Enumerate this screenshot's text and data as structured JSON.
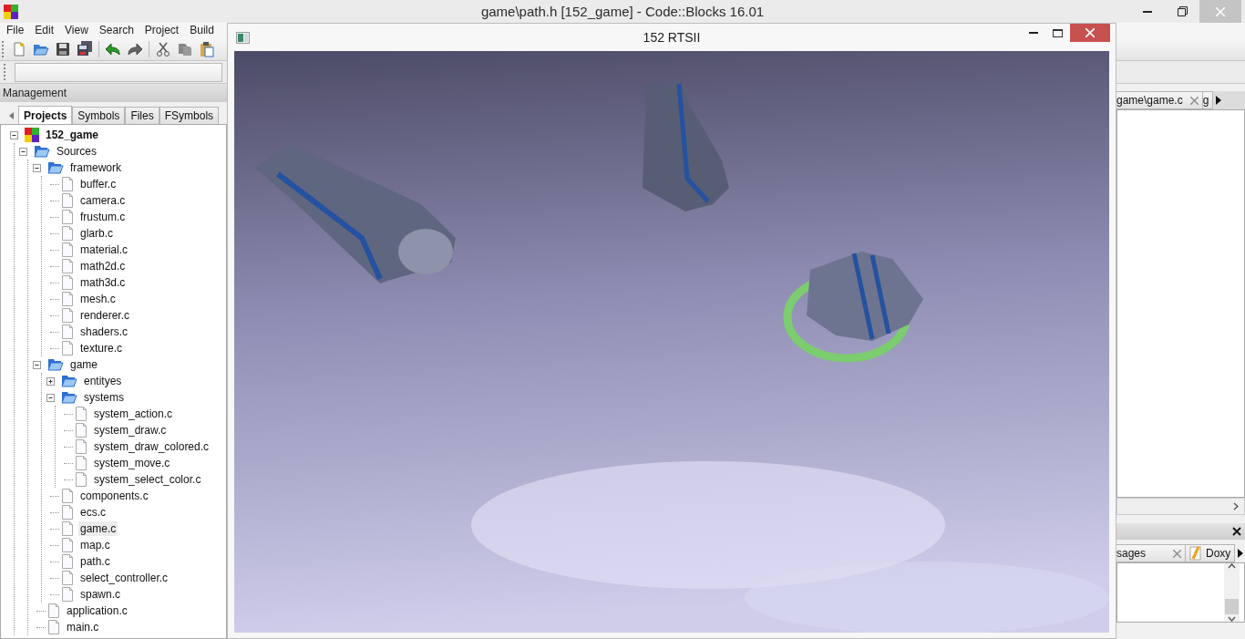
{
  "window": {
    "title": "game\\path.h [152_game] - Code::Blocks 16.01"
  },
  "menu": [
    "File",
    "Edit",
    "View",
    "Search",
    "Project",
    "Build"
  ],
  "management": {
    "title": "Management",
    "tabs": [
      {
        "label": "Projects",
        "selected": true
      },
      {
        "label": "Symbols",
        "selected": false
      },
      {
        "label": "Files",
        "selected": false
      },
      {
        "label": "FSymbols",
        "selected": false
      }
    ],
    "tree": [
      {
        "kind": "project",
        "label": "152_game",
        "expanded": true,
        "selected": false,
        "children": [
          {
            "kind": "folder",
            "label": "Sources",
            "expanded": true,
            "selected": false,
            "children": [
              {
                "kind": "folder",
                "label": "framework",
                "expanded": true,
                "selected": false,
                "children": [
                  {
                    "kind": "file",
                    "label": "buffer.c",
                    "selected": false
                  },
                  {
                    "kind": "file",
                    "label": "camera.c",
                    "selected": false
                  },
                  {
                    "kind": "file",
                    "label": "frustum.c",
                    "selected": false
                  },
                  {
                    "kind": "file",
                    "label": "glarb.c",
                    "selected": false
                  },
                  {
                    "kind": "file",
                    "label": "material.c",
                    "selected": false
                  },
                  {
                    "kind": "file",
                    "label": "math2d.c",
                    "selected": false
                  },
                  {
                    "kind": "file",
                    "label": "math3d.c",
                    "selected": false
                  },
                  {
                    "kind": "file",
                    "label": "mesh.c",
                    "selected": false
                  },
                  {
                    "kind": "file",
                    "label": "renderer.c",
                    "selected": false
                  },
                  {
                    "kind": "file",
                    "label": "shaders.c",
                    "selected": false
                  },
                  {
                    "kind": "file",
                    "label": "texture.c",
                    "selected": false
                  }
                ]
              },
              {
                "kind": "folder",
                "label": "game",
                "expanded": true,
                "selected": false,
                "children": [
                  {
                    "kind": "folder",
                    "label": "entityes",
                    "expanded": false,
                    "selected": false
                  },
                  {
                    "kind": "folder",
                    "label": "systems",
                    "expanded": true,
                    "selected": false,
                    "children": [
                      {
                        "kind": "file",
                        "label": "system_action.c",
                        "selected": false
                      },
                      {
                        "kind": "file",
                        "label": "system_draw.c",
                        "selected": false
                      },
                      {
                        "kind": "file",
                        "label": "system_draw_colored.c",
                        "selected": false
                      },
                      {
                        "kind": "file",
                        "label": "system_move.c",
                        "selected": false
                      },
                      {
                        "kind": "file",
                        "label": "system_select_color.c",
                        "selected": false
                      }
                    ]
                  },
                  {
                    "kind": "file",
                    "label": "components.c",
                    "selected": false
                  },
                  {
                    "kind": "file",
                    "label": "ecs.c",
                    "selected": false
                  },
                  {
                    "kind": "file",
                    "label": "game.c",
                    "selected": true
                  },
                  {
                    "kind": "file",
                    "label": "map.c",
                    "selected": false
                  },
                  {
                    "kind": "file",
                    "label": "path.c",
                    "selected": false
                  },
                  {
                    "kind": "file",
                    "label": "select_controller.c",
                    "selected": false
                  },
                  {
                    "kind": "file",
                    "label": "spawn.c",
                    "selected": false
                  }
                ]
              },
              {
                "kind": "file",
                "label": "application.c",
                "selected": false
              },
              {
                "kind": "file",
                "label": "main.c",
                "selected": false
              }
            ]
          }
        ]
      }
    ]
  },
  "editor_tabs": [
    {
      "label": "game\\game.c",
      "closable": true
    },
    {
      "label": "g",
      "closable": false
    }
  ],
  "logs": {
    "tabs": [
      {
        "label": "sages",
        "closable": true,
        "kind": "plain"
      },
      {
        "label": "Doxy",
        "closable": false,
        "kind": "doxygen"
      }
    ]
  },
  "game_window": {
    "title": "152 RTSII"
  }
}
